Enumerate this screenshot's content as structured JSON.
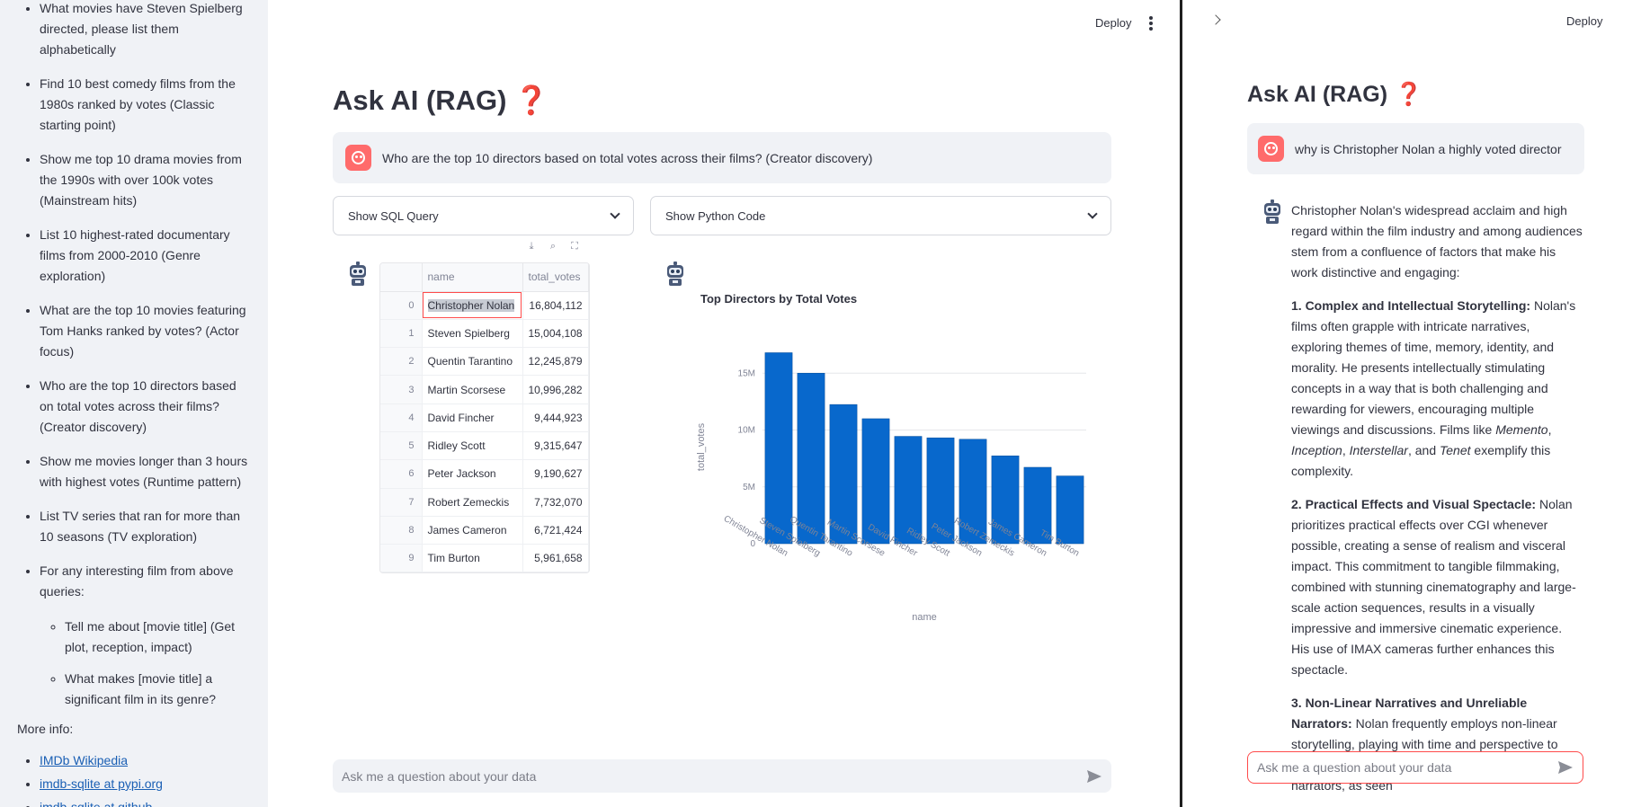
{
  "sidebar": {
    "questions": [
      "What movies have Steven Spielberg directed, please list them alphabetically",
      "Find 10 best comedy films from the 1980s ranked by votes (Classic starting point)",
      "Show me top 10 drama movies from the 1990s with over 100k votes (Mainstream hits)",
      "List 10 highest-rated documentary films from 2000-2010 (Genre exploration)",
      "What are the top 10 movies featuring Tom Hanks ranked by votes? (Actor focus)",
      "Who are the top 10 directors based on total votes across their films? (Creator discovery)",
      "Show me movies longer than 3 hours with highest votes (Runtime pattern)",
      "List TV series that ran for more than 10 seasons (TV exploration)",
      "For any interesting film from above queries:"
    ],
    "sub_questions": [
      "Tell me about [movie title] (Get plot, reception, impact)",
      "What makes [movie title] a significant film in its genre?"
    ],
    "more_info_label": "More info:",
    "links": [
      "IMDb Wikipedia",
      "imdb-sqlite at pypi.org",
      "imdb-sqlite at github"
    ]
  },
  "main": {
    "deploy_label": "Deploy",
    "title": "Ask AI (RAG)",
    "title_emoji": "❓",
    "user_question": "Who are the top 10 directors based on total votes across their films? (Creator discovery)",
    "expander_sql": "Show SQL Query",
    "expander_python": "Show Python Code",
    "dataframe": {
      "columns": [
        "name",
        "total_votes"
      ],
      "rows": [
        {
          "idx": "0",
          "name": "Christopher Nolan",
          "votes": "16,804,112"
        },
        {
          "idx": "1",
          "name": "Steven Spielberg",
          "votes": "15,004,108"
        },
        {
          "idx": "2",
          "name": "Quentin Tarantino",
          "votes": "12,245,879"
        },
        {
          "idx": "3",
          "name": "Martin Scorsese",
          "votes": "10,996,282"
        },
        {
          "idx": "4",
          "name": "David Fincher",
          "votes": "9,444,923"
        },
        {
          "idx": "5",
          "name": "Ridley Scott",
          "votes": "9,315,647"
        },
        {
          "idx": "6",
          "name": "Peter Jackson",
          "votes": "9,190,627"
        },
        {
          "idx": "7",
          "name": "Robert Zemeckis",
          "votes": "7,732,070"
        },
        {
          "idx": "8",
          "name": "James Cameron",
          "votes": "6,721,424"
        },
        {
          "idx": "9",
          "name": "Tim Burton",
          "votes": "5,961,658"
        }
      ]
    },
    "chat_placeholder": "Ask me a question about your data"
  },
  "chart_data": {
    "type": "bar",
    "title": "Top Directors by Total Votes",
    "xlabel": "name",
    "ylabel": "total_votes",
    "categories": [
      "Christopher Nolan",
      "Steven Spielberg",
      "Quentin Tarantino",
      "Martin Scorsese",
      "David Fincher",
      "Ridley Scott",
      "Peter Jackson",
      "Robert Zemeckis",
      "James Cameron",
      "Tim Burton"
    ],
    "values": [
      16804112,
      15004108,
      12245879,
      10996282,
      9444923,
      9315647,
      9190627,
      7732070,
      6721424,
      5961658
    ],
    "yticks": [
      0,
      5000000,
      10000000,
      15000000
    ],
    "ytick_labels": [
      "0",
      "5M",
      "10M",
      "15M"
    ],
    "ylim": [
      0,
      17000000
    ],
    "grid": true,
    "bar_color": "#0868cc"
  },
  "right_panel": {
    "deploy_label": "Deploy",
    "title": "Ask AI (RAG)",
    "title_emoji": "❓",
    "user_question": "why is Christopher Nolan a highly voted director",
    "answer": [
      "Christopher Nolan's widespread acclaim and high regard within the film industry and among audiences stem from a confluence of factors that make his work distinctive and engaging:",
      {
        "heading": "1. Complex and Intellectual Storytelling:",
        "text": " Nolan's films often grapple with intricate narratives, exploring themes of time, memory, identity, and morality. He presents intellectually stimulating concepts in a way that is both challenging and rewarding for viewers, encouraging multiple viewings and discussions. Films like ",
        "em1": "Memento",
        "sep1": ", ",
        "em2": "Inception",
        "sep2": ", ",
        "em3": "Interstellar",
        "sep3": ", and ",
        "em4": "Tenet",
        "tail": " exemplify this complexity."
      },
      {
        "heading": "2. Practical Effects and Visual Spectacle:",
        "text": " Nolan prioritizes practical effects over CGI whenever possible, creating a sense of realism and visceral impact. This commitment to tangible filmmaking, combined with stunning cinematography and large-scale action sequences, results in a visually impressive and immersive cinematic experience. His use of IMAX cameras further enhances this spectacle."
      },
      {
        "heading": "3. Non-Linear Narratives and Unreliable Narrators:",
        "text": " Nolan frequently employs non-linear storytelling, playing with time and perspective to create suspense and intrigue. The use of unreliable narrators, as seen"
      }
    ],
    "chat_placeholder": "Ask me a question about your data"
  },
  "colors": {
    "accent": "#ff4b4b",
    "sidebar_bg": "#f0f2f6",
    "link": "#1a5fb4",
    "bar": "#0868cc"
  }
}
